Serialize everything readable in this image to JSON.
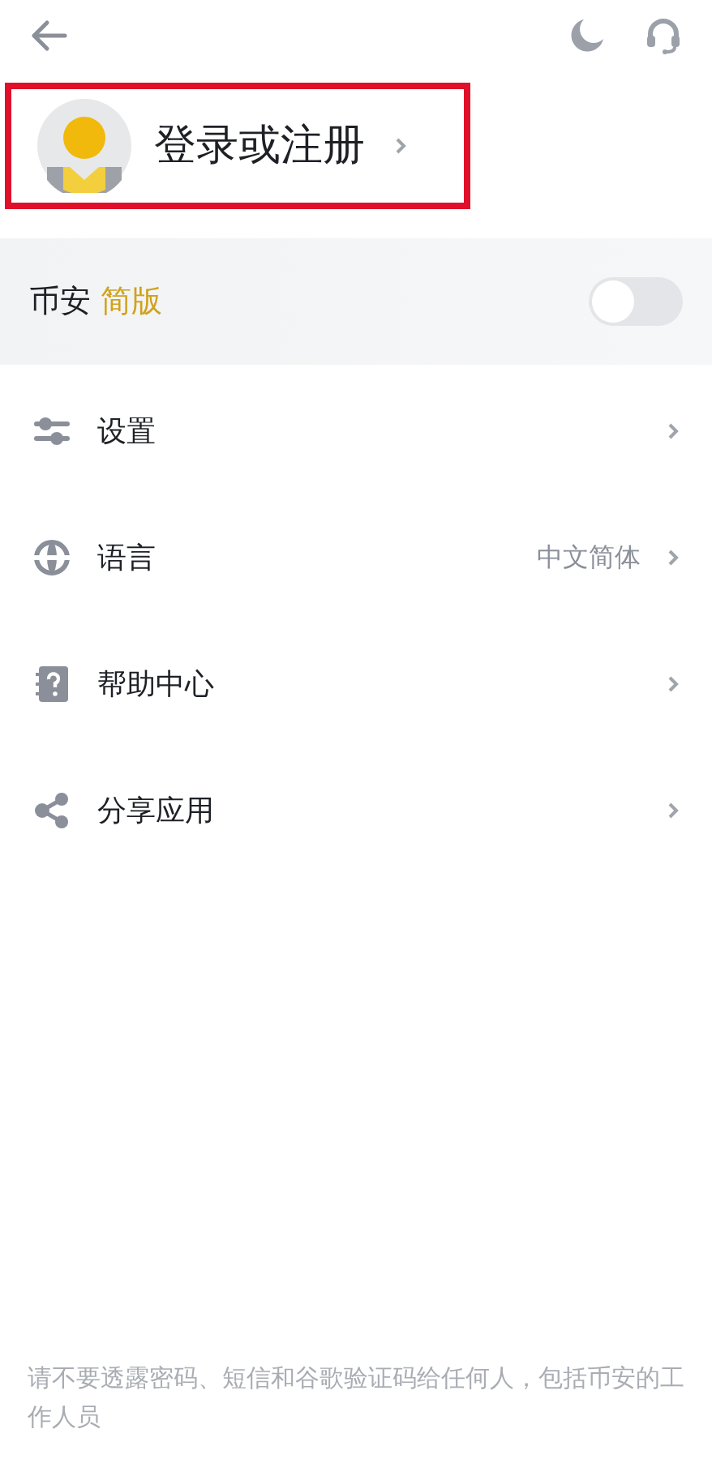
{
  "header": {
    "title": "登录或注册",
    "highlighted": true
  },
  "lite_mode": {
    "label": "币安",
    "accent": "简版",
    "on": false
  },
  "menu": [
    {
      "kind": "settings",
      "label": "设置"
    },
    {
      "kind": "language",
      "label": "语言",
      "value": "中文简体"
    },
    {
      "kind": "help",
      "label": "帮助中心"
    },
    {
      "kind": "share",
      "label": "分享应用"
    }
  ],
  "footer_note": "请不要透露密码、短信和谷歌验证码给任何人，包括币安的工作人员"
}
